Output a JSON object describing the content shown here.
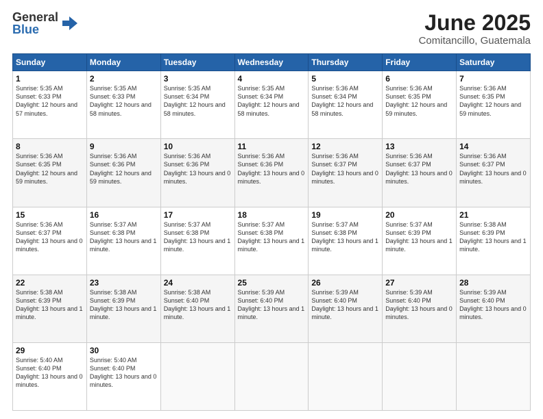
{
  "logo": {
    "general": "General",
    "blue": "Blue"
  },
  "title": "June 2025",
  "subtitle": "Comitancillo, Guatemala",
  "days_of_week": [
    "Sunday",
    "Monday",
    "Tuesday",
    "Wednesday",
    "Thursday",
    "Friday",
    "Saturday"
  ],
  "weeks": [
    [
      {
        "day": "1",
        "sunrise": "Sunrise: 5:35 AM",
        "sunset": "Sunset: 6:33 PM",
        "daylight": "Daylight: 12 hours and 57 minutes."
      },
      {
        "day": "2",
        "sunrise": "Sunrise: 5:35 AM",
        "sunset": "Sunset: 6:33 PM",
        "daylight": "Daylight: 12 hours and 58 minutes."
      },
      {
        "day": "3",
        "sunrise": "Sunrise: 5:35 AM",
        "sunset": "Sunset: 6:34 PM",
        "daylight": "Daylight: 12 hours and 58 minutes."
      },
      {
        "day": "4",
        "sunrise": "Sunrise: 5:35 AM",
        "sunset": "Sunset: 6:34 PM",
        "daylight": "Daylight: 12 hours and 58 minutes."
      },
      {
        "day": "5",
        "sunrise": "Sunrise: 5:36 AM",
        "sunset": "Sunset: 6:34 PM",
        "daylight": "Daylight: 12 hours and 58 minutes."
      },
      {
        "day": "6",
        "sunrise": "Sunrise: 5:36 AM",
        "sunset": "Sunset: 6:35 PM",
        "daylight": "Daylight: 12 hours and 59 minutes."
      },
      {
        "day": "7",
        "sunrise": "Sunrise: 5:36 AM",
        "sunset": "Sunset: 6:35 PM",
        "daylight": "Daylight: 12 hours and 59 minutes."
      }
    ],
    [
      {
        "day": "8",
        "sunrise": "Sunrise: 5:36 AM",
        "sunset": "Sunset: 6:35 PM",
        "daylight": "Daylight: 12 hours and 59 minutes."
      },
      {
        "day": "9",
        "sunrise": "Sunrise: 5:36 AM",
        "sunset": "Sunset: 6:36 PM",
        "daylight": "Daylight: 12 hours and 59 minutes."
      },
      {
        "day": "10",
        "sunrise": "Sunrise: 5:36 AM",
        "sunset": "Sunset: 6:36 PM",
        "daylight": "Daylight: 13 hours and 0 minutes."
      },
      {
        "day": "11",
        "sunrise": "Sunrise: 5:36 AM",
        "sunset": "Sunset: 6:36 PM",
        "daylight": "Daylight: 13 hours and 0 minutes."
      },
      {
        "day": "12",
        "sunrise": "Sunrise: 5:36 AM",
        "sunset": "Sunset: 6:37 PM",
        "daylight": "Daylight: 13 hours and 0 minutes."
      },
      {
        "day": "13",
        "sunrise": "Sunrise: 5:36 AM",
        "sunset": "Sunset: 6:37 PM",
        "daylight": "Daylight: 13 hours and 0 minutes."
      },
      {
        "day": "14",
        "sunrise": "Sunrise: 5:36 AM",
        "sunset": "Sunset: 6:37 PM",
        "daylight": "Daylight: 13 hours and 0 minutes."
      }
    ],
    [
      {
        "day": "15",
        "sunrise": "Sunrise: 5:36 AM",
        "sunset": "Sunset: 6:37 PM",
        "daylight": "Daylight: 13 hours and 0 minutes."
      },
      {
        "day": "16",
        "sunrise": "Sunrise: 5:37 AM",
        "sunset": "Sunset: 6:38 PM",
        "daylight": "Daylight: 13 hours and 1 minute."
      },
      {
        "day": "17",
        "sunrise": "Sunrise: 5:37 AM",
        "sunset": "Sunset: 6:38 PM",
        "daylight": "Daylight: 13 hours and 1 minute."
      },
      {
        "day": "18",
        "sunrise": "Sunrise: 5:37 AM",
        "sunset": "Sunset: 6:38 PM",
        "daylight": "Daylight: 13 hours and 1 minute."
      },
      {
        "day": "19",
        "sunrise": "Sunrise: 5:37 AM",
        "sunset": "Sunset: 6:38 PM",
        "daylight": "Daylight: 13 hours and 1 minute."
      },
      {
        "day": "20",
        "sunrise": "Sunrise: 5:37 AM",
        "sunset": "Sunset: 6:39 PM",
        "daylight": "Daylight: 13 hours and 1 minute."
      },
      {
        "day": "21",
        "sunrise": "Sunrise: 5:38 AM",
        "sunset": "Sunset: 6:39 PM",
        "daylight": "Daylight: 13 hours and 1 minute."
      }
    ],
    [
      {
        "day": "22",
        "sunrise": "Sunrise: 5:38 AM",
        "sunset": "Sunset: 6:39 PM",
        "daylight": "Daylight: 13 hours and 1 minute."
      },
      {
        "day": "23",
        "sunrise": "Sunrise: 5:38 AM",
        "sunset": "Sunset: 6:39 PM",
        "daylight": "Daylight: 13 hours and 1 minute."
      },
      {
        "day": "24",
        "sunrise": "Sunrise: 5:38 AM",
        "sunset": "Sunset: 6:40 PM",
        "daylight": "Daylight: 13 hours and 1 minute."
      },
      {
        "day": "25",
        "sunrise": "Sunrise: 5:39 AM",
        "sunset": "Sunset: 6:40 PM",
        "daylight": "Daylight: 13 hours and 1 minute."
      },
      {
        "day": "26",
        "sunrise": "Sunrise: 5:39 AM",
        "sunset": "Sunset: 6:40 PM",
        "daylight": "Daylight: 13 hours and 1 minute."
      },
      {
        "day": "27",
        "sunrise": "Sunrise: 5:39 AM",
        "sunset": "Sunset: 6:40 PM",
        "daylight": "Daylight: 13 hours and 0 minutes."
      },
      {
        "day": "28",
        "sunrise": "Sunrise: 5:39 AM",
        "sunset": "Sunset: 6:40 PM",
        "daylight": "Daylight: 13 hours and 0 minutes."
      }
    ],
    [
      {
        "day": "29",
        "sunrise": "Sunrise: 5:40 AM",
        "sunset": "Sunset: 6:40 PM",
        "daylight": "Daylight: 13 hours and 0 minutes."
      },
      {
        "day": "30",
        "sunrise": "Sunrise: 5:40 AM",
        "sunset": "Sunset: 6:40 PM",
        "daylight": "Daylight: 13 hours and 0 minutes."
      },
      null,
      null,
      null,
      null,
      null
    ]
  ]
}
